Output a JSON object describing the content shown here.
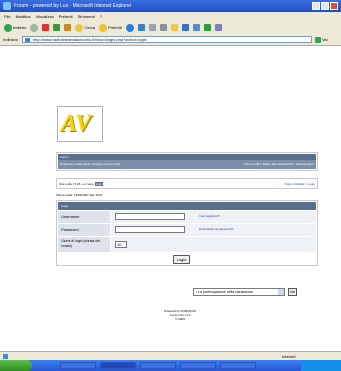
{
  "window": {
    "title": "Forum - powered by Lus - Microsoft Internet Explorer"
  },
  "menu": {
    "items": [
      "File",
      "Modifica",
      "Visualizza",
      "Preferiti",
      "Strumenti",
      "?"
    ]
  },
  "toolbar": {
    "back": "Indietro",
    "search": "Cerca",
    "favorites": "Preferiti"
  },
  "address": {
    "label": "Indirizzo",
    "url": "http://www.radiotelearbalavicchio.it/forum/login.php?action=login",
    "go": "Vai"
  },
  "logo": {
    "text": "AV"
  },
  "forum_header": {
    "title": "Forum",
    "nav_left": "Registrati | Lista utenti | Gruppi | Cerca | FAQ",
    "nav_right": "Forum online 'Radio Tele Arbavicchio' / Mostra topics"
  },
  "time_bar": {
    "text": "Ora è alle 17:26, e ci sono",
    "tag": "login",
    "right": "Topic principali > Login"
  },
  "last_visit": "Ultima visita: 14/09/2007 alle 15:07",
  "login": {
    "header": "Login",
    "username_label": "Username",
    "password_label": "Password",
    "days_label": "Giorni di login (durata del cookie)",
    "days_value": "10",
    "register_link": "Vuoi registrarti?",
    "forgot_link": "Dimenticato la password?",
    "button": "Login"
  },
  "jump": {
    "selected": "• La partecipazione nella valutazione",
    "go": "Vai"
  },
  "footer": {
    "line1": "Powered by FORUM AV",
    "line2": "Lus Forum v1.0",
    "line3": "© 2009"
  },
  "status": {
    "zone": "Internet"
  }
}
